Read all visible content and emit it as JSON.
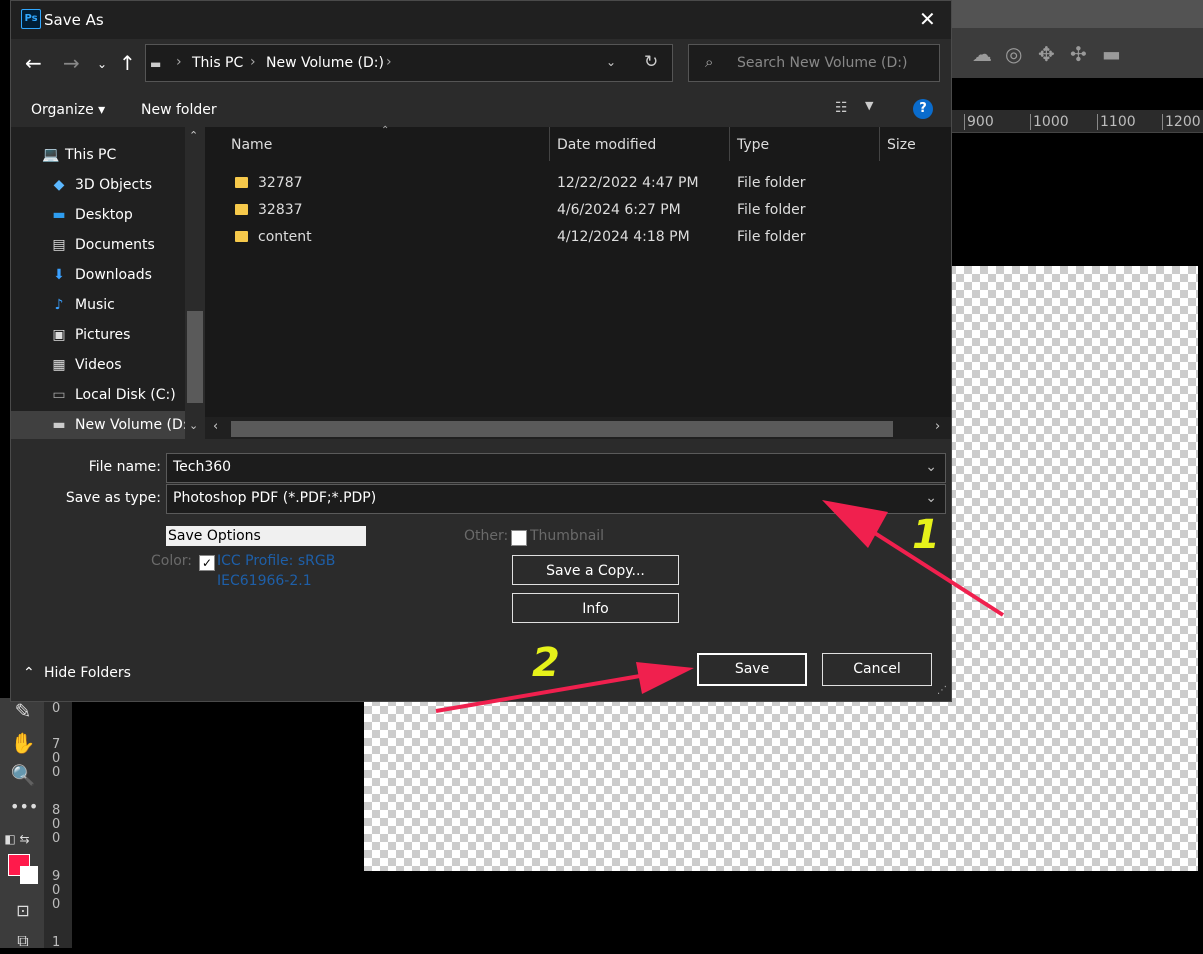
{
  "photoshop": {
    "ruler_ticks": [
      "900",
      "1000",
      "1100",
      "1200"
    ],
    "vertical_ruler": [
      "0",
      "7",
      "0",
      "0",
      "8",
      "0",
      "0",
      "9",
      "0",
      "0",
      "1"
    ],
    "foreground_color": "#ff1a4b"
  },
  "dialog": {
    "title": "Save As",
    "app_icon": "Ps",
    "address": {
      "crumbs": [
        "This PC",
        "New Volume (D:)"
      ]
    },
    "search": {
      "placeholder": "Search New Volume (D:)"
    },
    "command_bar": {
      "organize": "Organize ▾",
      "new_folder": "New folder"
    },
    "nav_pane": {
      "items": [
        {
          "label": "This PC",
          "icon": "computer-icon"
        },
        {
          "label": "3D Objects",
          "icon": "cube-icon"
        },
        {
          "label": "Desktop",
          "icon": "desktop-icon"
        },
        {
          "label": "Documents",
          "icon": "document-icon"
        },
        {
          "label": "Downloads",
          "icon": "download-icon"
        },
        {
          "label": "Music",
          "icon": "music-icon"
        },
        {
          "label": "Pictures",
          "icon": "pictures-icon"
        },
        {
          "label": "Videos",
          "icon": "video-icon"
        },
        {
          "label": "Local Disk (C:)",
          "icon": "drive-icon"
        },
        {
          "label": "New Volume (D:)",
          "icon": "drive-icon"
        }
      ]
    },
    "file_list": {
      "columns": [
        "Name",
        "Date modified",
        "Type",
        "Size"
      ],
      "rows": [
        {
          "name": "32787",
          "date": "12/22/2022 4:47 PM",
          "type": "File folder"
        },
        {
          "name": "32837",
          "date": "4/6/2024 6:27 PM",
          "type": "File folder"
        },
        {
          "name": "content",
          "date": "4/12/2024 4:18 PM",
          "type": "File folder"
        }
      ]
    },
    "form": {
      "file_name_label": "File name:",
      "file_name_value": "Tech360",
      "save_type_label": "Save as type:",
      "save_type_value": "Photoshop PDF (*.PDF;*.PDP)",
      "save_options": "Save Options",
      "color_label": "Color:",
      "icc_line1": "ICC Profile:  sRGB",
      "icc_line2": "IEC61966-2.1",
      "other_label": "Other:",
      "thumbnail_label": "Thumbnail",
      "save_copy_button": "Save a Copy...",
      "info_button": "Info",
      "hide_folders": "Hide Folders",
      "save_button": "Save",
      "cancel_button": "Cancel"
    }
  },
  "annotations": {
    "label_1": "1",
    "label_2": "2",
    "arrow_color": "#f0204e"
  }
}
